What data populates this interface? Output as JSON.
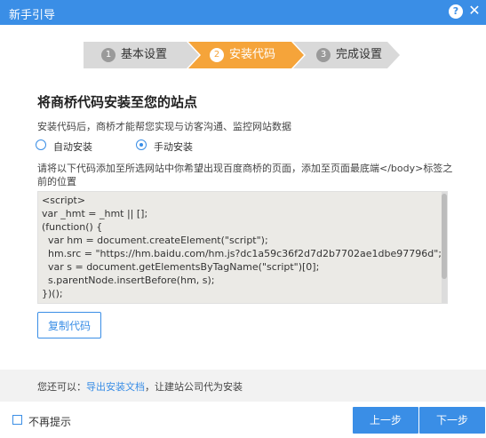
{
  "window": {
    "title": "新手引导",
    "help_icon": "help-icon",
    "close_icon": "close-icon",
    "accent": "#3a8ee6"
  },
  "steps": [
    {
      "num": "1",
      "label": "基本设置"
    },
    {
      "num": "2",
      "label": "安装代码"
    },
    {
      "num": "3",
      "label": "完成设置"
    }
  ],
  "active_step_color": "#f5a43a",
  "heading": "将商桥代码安装至您的站点",
  "description": "安装代码后，商桥才能帮您实现与访客沟通、监控网站数据",
  "install_options": [
    {
      "label": "自动安装",
      "checked": false
    },
    {
      "label": "手动安装",
      "checked": true
    }
  ],
  "instruction": "请将以下代码添加至所选网站中你希望出现百度商桥的页面，添加至页面最底端</body>标签之前的位置",
  "code_lines": [
    "<script>",
    "var _hmt = _hmt || [];",
    "(function() {",
    "  var hm = document.createElement(\"script\");",
    "  hm.src = \"https://hm.baidu.com/hm.js?dc1a59c36f2d7d2b7702ae1dbe97796d\";",
    "  var s = document.getElementsByTagName(\"script\")[0];",
    "  s.parentNode.insertBefore(hm, s);",
    "})();"
  ],
  "copy_button": "复制代码",
  "footer": {
    "prefix": "您还可以：",
    "link": "导出安装文档",
    "suffix": "，让建站公司代为安装"
  },
  "no_remind_label": "不再提示",
  "prev_button": "上一步",
  "next_button": "下一步"
}
